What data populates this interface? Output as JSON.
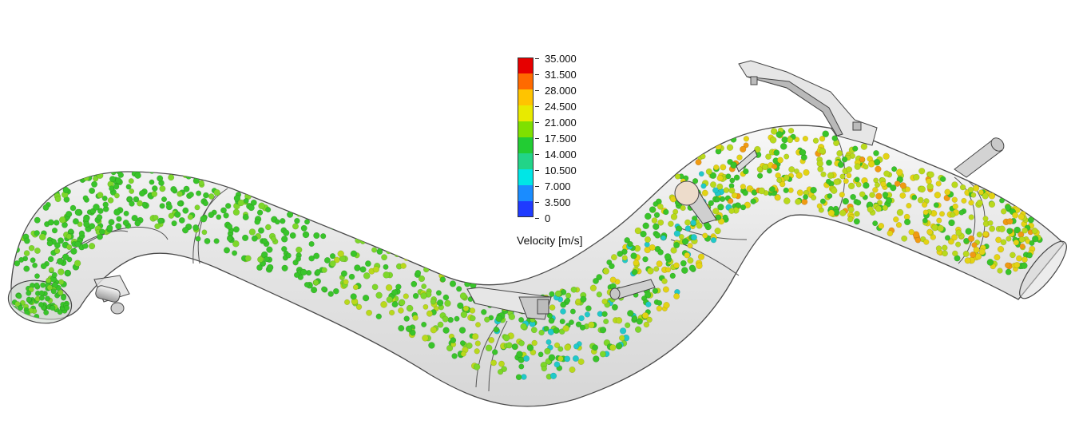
{
  "legend": {
    "title": "Velocity [m/s]",
    "ticks": [
      "35.000",
      "31.500",
      "28.000",
      "24.500",
      "21.000",
      "17.500",
      "14.000",
      "10.500",
      "7.000",
      "3.500",
      "0"
    ],
    "colors": [
      "#e60000",
      "#ff6a00",
      "#ffc400",
      "#e8ea00",
      "#7fe000",
      "#22cc33",
      "#22d488",
      "#00e6e6",
      "#1a8cff",
      "#1f3bff",
      "#0000e0"
    ]
  },
  "particle_colors": {
    "green": "#39c42a",
    "light_green": "#7dd72a",
    "yellow_green": "#b9d91c",
    "yellow": "#e3d314",
    "orange": "#f09a12",
    "cyan": "#21c9c9",
    "teal": "#2fc889"
  },
  "model": {
    "pipe_fill": "#d6d6d6",
    "pipe_edge": "#4a4a4a"
  }
}
